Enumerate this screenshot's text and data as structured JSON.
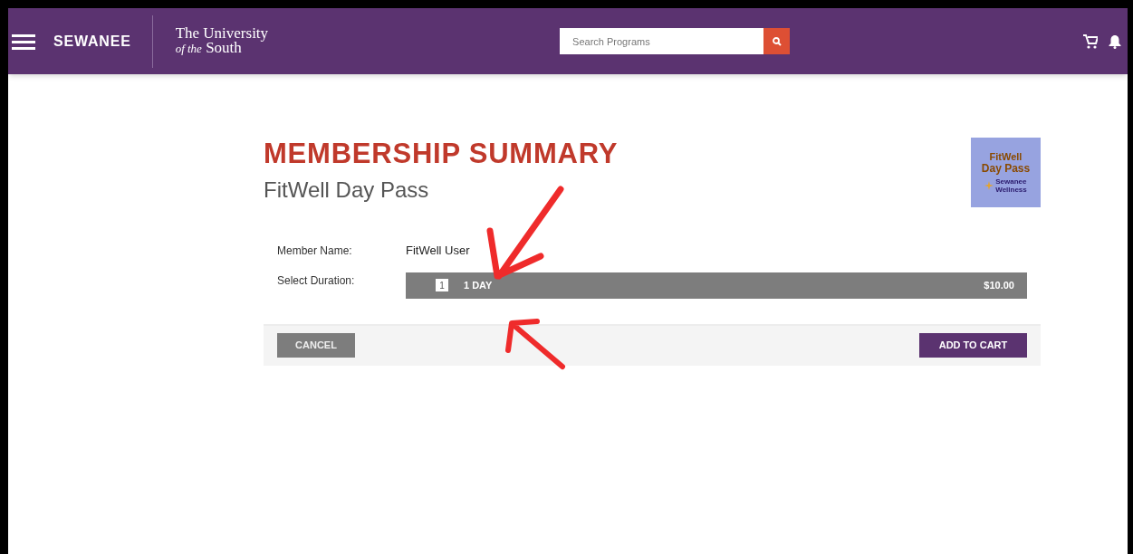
{
  "header": {
    "brand": "SEWANEE",
    "university_line1": "The University",
    "university_of_the": "of the",
    "university_line2": "South",
    "search": {
      "placeholder": "Search Programs"
    }
  },
  "summary": {
    "title": "MEMBERSHIP SUMMARY",
    "subtitle": "FitWell Day Pass",
    "tile": {
      "line1": "FitWell",
      "line2": "Day Pass",
      "org_line1": "Sewanee",
      "org_line2": "Wellness"
    }
  },
  "form": {
    "member_label": "Member Name:",
    "member_value": "FitWell User",
    "duration_label": "Select Duration:",
    "durations": [
      {
        "count": "1",
        "label": "1 DAY",
        "price": "$10.00",
        "selected": true
      }
    ]
  },
  "buttons": {
    "cancel": "CANCEL",
    "add": "ADD TO CART"
  }
}
